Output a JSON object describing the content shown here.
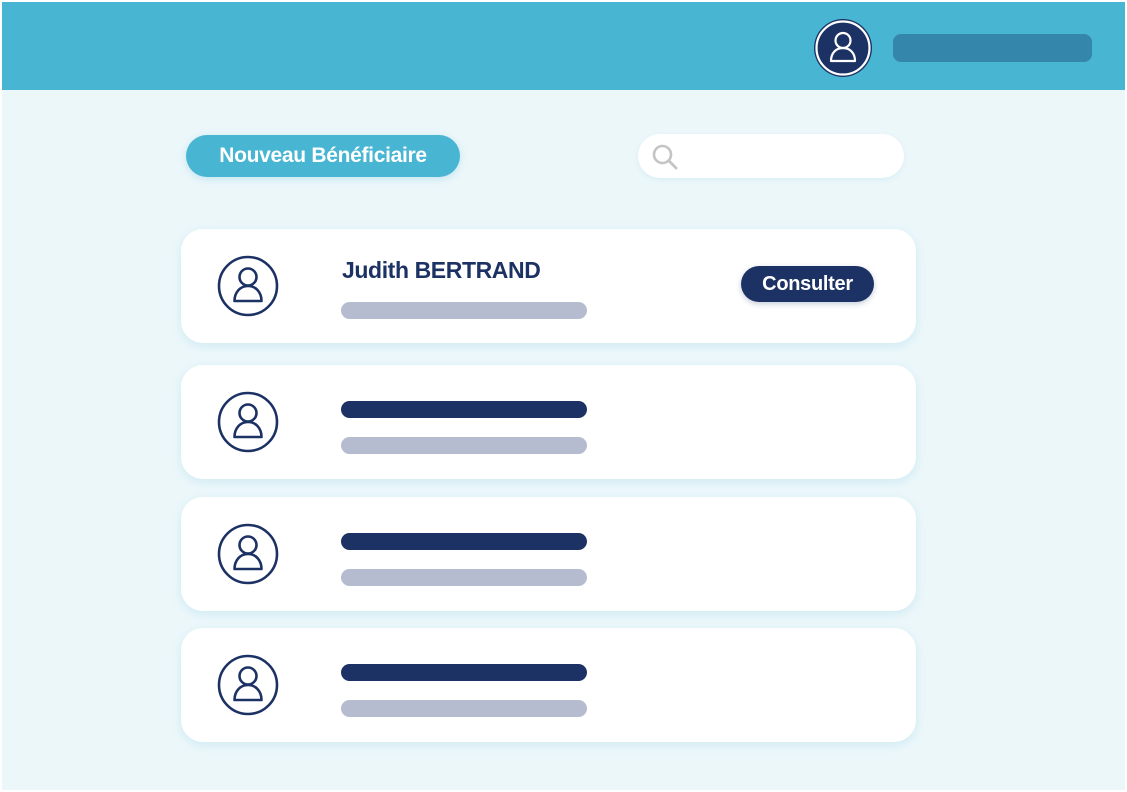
{
  "header": {
    "avatar_icon": "user-circle-icon",
    "accent_color": "#48b5d2",
    "bar_color": "#3586ab"
  },
  "toolbar": {
    "new_beneficiary_label": "Nouveau Bénéficiaire",
    "search_icon": "search-icon",
    "search_value": ""
  },
  "beneficiaries": [
    {
      "name": "Judith BERTRAND",
      "action_label": "Consulter",
      "avatar_icon": "user-icon"
    },
    {
      "avatar_icon": "user-icon"
    },
    {
      "avatar_icon": "user-icon"
    },
    {
      "avatar_icon": "user-icon"
    }
  ],
  "colors": {
    "navy": "#1d3264",
    "background": "#ecf7fa",
    "placeholder_grey": "#b5bccf"
  }
}
